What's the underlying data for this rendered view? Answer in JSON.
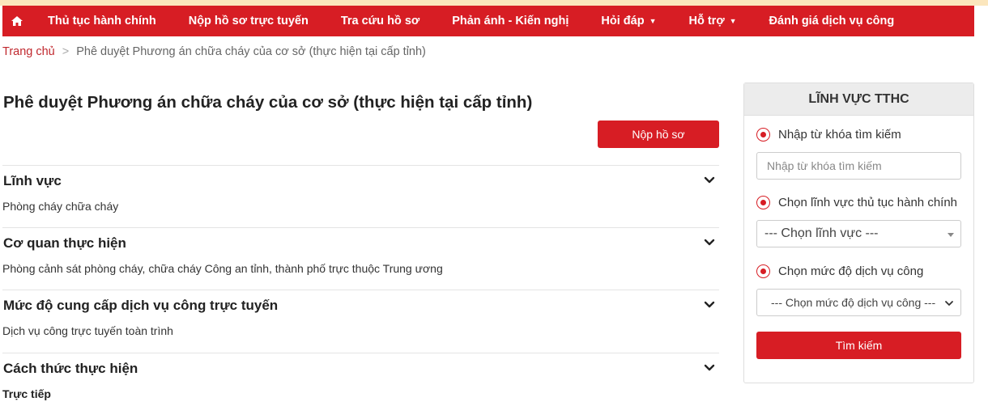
{
  "nav": {
    "home_icon": "home-icon",
    "items": [
      {
        "label": "Thủ tục hành chính"
      },
      {
        "label": "Nộp hồ sơ trực tuyến"
      },
      {
        "label": "Tra cứu hồ sơ"
      },
      {
        "label": "Phản ánh - Kiến nghị"
      },
      {
        "label": "Hỏi đáp"
      },
      {
        "label": "Hỗ trợ"
      },
      {
        "label": "Đánh giá dịch vụ công"
      }
    ]
  },
  "breadcrumb": {
    "home": "Trang chủ",
    "separator": ">",
    "current": "Phê duyệt Phương án chữa cháy của cơ sở (thực hiện tại cấp tỉnh)"
  },
  "main": {
    "title": "Phê duyệt Phương án chữa cháy của cơ sở (thực hiện tại cấp tỉnh)",
    "submit_label": "Nộp hồ sơ",
    "sections": [
      {
        "title": "Lĩnh vực",
        "value": "Phòng cháy chữa cháy"
      },
      {
        "title": "Cơ quan thực hiện",
        "value": "Phòng cảnh sát phòng cháy, chữa cháy Công an tỉnh, thành phố trực thuộc Trung ương"
      },
      {
        "title": "Mức độ cung cấp dịch vụ công trực tuyến",
        "value": "Dịch vụ công trực tuyến toàn trình"
      },
      {
        "title": "Cách thức thực hiện",
        "value": "Trực tiếp"
      }
    ]
  },
  "sidebar": {
    "title": "LĨNH VỰC TTHC",
    "keyword_radio": "Nhập từ khóa tìm kiếm",
    "keyword_placeholder": "Nhập từ khóa tìm kiếm",
    "field_radio": "Chọn lĩnh vực thủ tục hành chính",
    "field_select": "--- Chọn lĩnh vực ---",
    "level_radio": "Chọn mức độ dịch vụ công",
    "level_select": "--- Chọn mức độ dịch vụ công ---",
    "search_label": "Tìm kiếm"
  },
  "colors": {
    "brand_red": "#d71d24",
    "top_strip": "#fbe6bd"
  }
}
